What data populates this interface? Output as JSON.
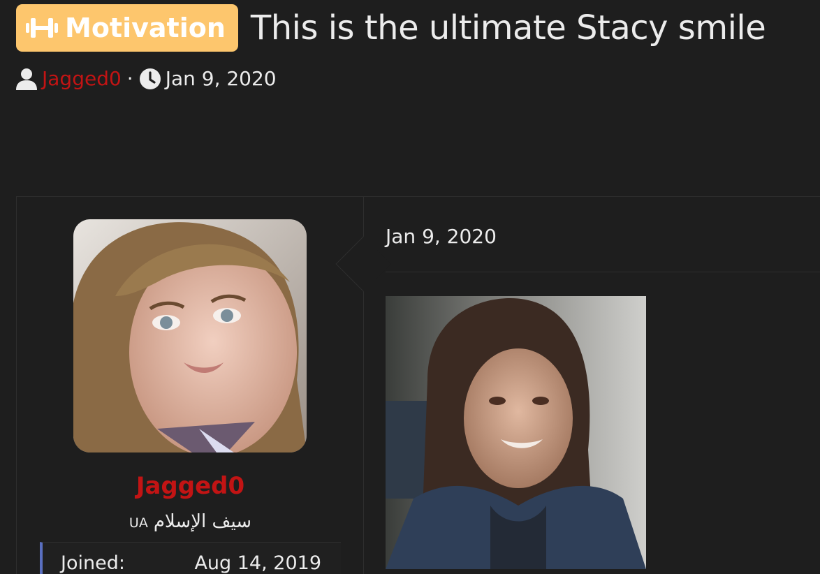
{
  "thread": {
    "prefix_label": "Motivation",
    "prefix_icon": "dumbbell-icon",
    "prefix_color": "#fdc66d",
    "title": "This is the ultimate Stacy smile",
    "author": "Jagged0",
    "date": "Jan 9, 2020"
  },
  "post": {
    "user": {
      "name": "Jagged0",
      "title": "سيف الإسلام",
      "flag": "UA",
      "joined_label": "Joined:",
      "joined_value": "Aug 14, 2019"
    },
    "date": "Jan 9, 2020"
  },
  "colors": {
    "background": "#1e1e1e",
    "username": "#c21414",
    "text": "#ececec"
  }
}
